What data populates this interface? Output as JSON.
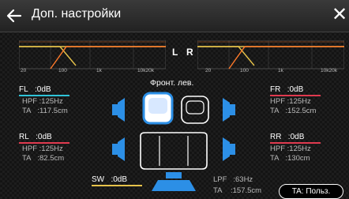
{
  "header": {
    "title": "Доп. настройки",
    "close": "✕"
  },
  "graph": {
    "left_ticks": [
      "20",
      "100",
      "1k",
      "10k20k"
    ],
    "right_ticks": [
      "20",
      "100",
      "1k",
      "10k20k"
    ],
    "l_label": "L",
    "r_label": "R"
  },
  "listening_position": "Фронт. лев.",
  "channels": {
    "fl": {
      "name": "FL",
      "gain": ":0dB",
      "hpf_label": "HPF",
      "hpf": ":125Hz",
      "ta_label": "TA",
      "ta": ":117.5cm"
    },
    "fr": {
      "name": "FR",
      "gain": ":0dB",
      "hpf_label": "HPF",
      "hpf": ":125Hz",
      "ta_label": "TA",
      "ta": ":152.5cm"
    },
    "rl": {
      "name": "RL",
      "gain": ":0dB",
      "hpf_label": "HPF",
      "hpf": ":125Hz",
      "ta_label": "TA",
      "ta": ":82.5cm"
    },
    "rr": {
      "name": "RR",
      "gain": ":0dB",
      "hpf_label": "HPF",
      "hpf": ":125Hz",
      "ta_label": "TA",
      "ta": ":130cm"
    },
    "sw": {
      "name": "SW",
      "gain": ":0dB",
      "lpf_label": "LPF",
      "lpf": ":63Hz",
      "ta_label": "TA",
      "ta": ":157.5cm"
    }
  },
  "ta_user_button": "TA: Польз.",
  "colors": {
    "accent_cyan": "#2f9fd8",
    "speaker_blue": "#2c8fe6",
    "curve_yellow": "#e6c24a",
    "curve_orange": "#ff7a2a",
    "underline_fl": "#2fc3d8",
    "underline_red": "#e03a4f",
    "underline_sw": "#e6c24a"
  }
}
